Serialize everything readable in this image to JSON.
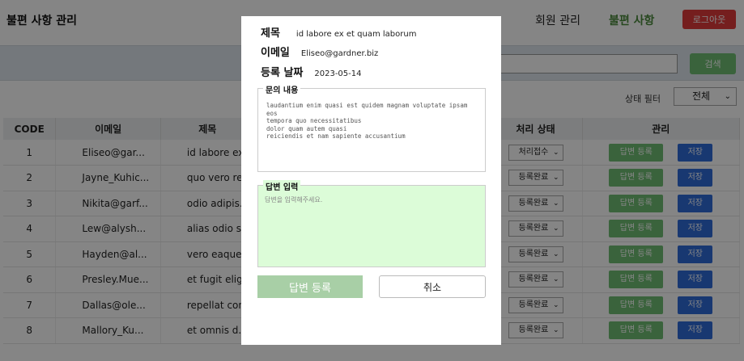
{
  "header": {
    "brand": "불편 사항 관리",
    "nav_member": "회원 관리",
    "nav_complaint": "불편 사항",
    "logout_label": "로그아웃"
  },
  "search": {
    "button_label": "검색"
  },
  "filter": {
    "label": "상태 필터",
    "selected": "전체"
  },
  "table": {
    "columns": [
      "CODE",
      "이메일",
      "제목",
      "",
      "처리 상태",
      "관리"
    ],
    "reply_label": "답변 등록",
    "save_label": "저장",
    "rows": [
      {
        "code": "1",
        "email": "Eliseo@gar...",
        "title": "id labore ex...",
        "status": "처리접수"
      },
      {
        "code": "2",
        "email": "Jayne_Kuhic...",
        "title": "quo vero re...",
        "status": "등록완료"
      },
      {
        "code": "3",
        "email": "Nikita@garf...",
        "title": "odio adipis...",
        "status": "등록완료"
      },
      {
        "code": "4",
        "email": "Lew@alysh...",
        "title": " alias odio sit",
        "status": "등록완료"
      },
      {
        "code": "5",
        "email": "Hayden@al...",
        "title": "vero eaque ...",
        "status": "등록완료"
      },
      {
        "code": "6",
        "email": "Presley.Mue...",
        "title": "et fugit elig...",
        "status": "등록완료"
      },
      {
        "code": "7",
        "email": "Dallas@ole...",
        "title": "repellat con...",
        "status": "등록완료"
      },
      {
        "code": "8",
        "email": "Mallory_Ku...",
        "title": "et omnis d...",
        "status": "등록완료"
      }
    ]
  },
  "modal": {
    "title_label": "제목",
    "title_value": "id labore ex et quam laborum",
    "email_label": "이메일",
    "email_value": "Eliseo@gardner.biz",
    "date_label": "등록 날짜",
    "date_value": "2023-05-14",
    "inquiry_legend": "문의 내용",
    "inquiry_text": "laudantium enim quasi est quidem magnam voluptate ipsam eos\ntempora quo necessitatibus\ndolor quam autem quasi\nreiciendis et nam sapiente accusantium",
    "answer_legend": "답변 입력",
    "answer_placeholder": "답변을 입력해주세요.",
    "submit_label": "답변 등록",
    "cancel_label": "취소"
  }
}
